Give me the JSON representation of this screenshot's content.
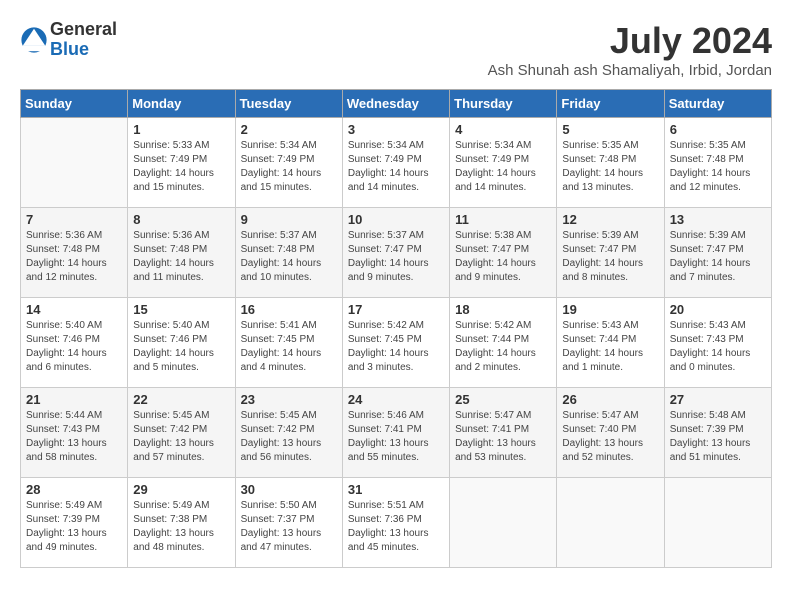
{
  "logo": {
    "general": "General",
    "blue": "Blue"
  },
  "title": "July 2024",
  "location": "Ash Shunah ash Shamaliyah, Irbid, Jordan",
  "weekdays": [
    "Sunday",
    "Monday",
    "Tuesday",
    "Wednesday",
    "Thursday",
    "Friday",
    "Saturday"
  ],
  "weeks": [
    [
      {
        "day": "",
        "sunrise": "",
        "sunset": "",
        "daylight": ""
      },
      {
        "day": "1",
        "sunrise": "Sunrise: 5:33 AM",
        "sunset": "Sunset: 7:49 PM",
        "daylight": "Daylight: 14 hours and 15 minutes."
      },
      {
        "day": "2",
        "sunrise": "Sunrise: 5:34 AM",
        "sunset": "Sunset: 7:49 PM",
        "daylight": "Daylight: 14 hours and 15 minutes."
      },
      {
        "day": "3",
        "sunrise": "Sunrise: 5:34 AM",
        "sunset": "Sunset: 7:49 PM",
        "daylight": "Daylight: 14 hours and 14 minutes."
      },
      {
        "day": "4",
        "sunrise": "Sunrise: 5:34 AM",
        "sunset": "Sunset: 7:49 PM",
        "daylight": "Daylight: 14 hours and 14 minutes."
      },
      {
        "day": "5",
        "sunrise": "Sunrise: 5:35 AM",
        "sunset": "Sunset: 7:48 PM",
        "daylight": "Daylight: 14 hours and 13 minutes."
      },
      {
        "day": "6",
        "sunrise": "Sunrise: 5:35 AM",
        "sunset": "Sunset: 7:48 PM",
        "daylight": "Daylight: 14 hours and 12 minutes."
      }
    ],
    [
      {
        "day": "7",
        "sunrise": "Sunrise: 5:36 AM",
        "sunset": "Sunset: 7:48 PM",
        "daylight": "Daylight: 14 hours and 12 minutes."
      },
      {
        "day": "8",
        "sunrise": "Sunrise: 5:36 AM",
        "sunset": "Sunset: 7:48 PM",
        "daylight": "Daylight: 14 hours and 11 minutes."
      },
      {
        "day": "9",
        "sunrise": "Sunrise: 5:37 AM",
        "sunset": "Sunset: 7:48 PM",
        "daylight": "Daylight: 14 hours and 10 minutes."
      },
      {
        "day": "10",
        "sunrise": "Sunrise: 5:37 AM",
        "sunset": "Sunset: 7:47 PM",
        "daylight": "Daylight: 14 hours and 9 minutes."
      },
      {
        "day": "11",
        "sunrise": "Sunrise: 5:38 AM",
        "sunset": "Sunset: 7:47 PM",
        "daylight": "Daylight: 14 hours and 9 minutes."
      },
      {
        "day": "12",
        "sunrise": "Sunrise: 5:39 AM",
        "sunset": "Sunset: 7:47 PM",
        "daylight": "Daylight: 14 hours and 8 minutes."
      },
      {
        "day": "13",
        "sunrise": "Sunrise: 5:39 AM",
        "sunset": "Sunset: 7:47 PM",
        "daylight": "Daylight: 14 hours and 7 minutes."
      }
    ],
    [
      {
        "day": "14",
        "sunrise": "Sunrise: 5:40 AM",
        "sunset": "Sunset: 7:46 PM",
        "daylight": "Daylight: 14 hours and 6 minutes."
      },
      {
        "day": "15",
        "sunrise": "Sunrise: 5:40 AM",
        "sunset": "Sunset: 7:46 PM",
        "daylight": "Daylight: 14 hours and 5 minutes."
      },
      {
        "day": "16",
        "sunrise": "Sunrise: 5:41 AM",
        "sunset": "Sunset: 7:45 PM",
        "daylight": "Daylight: 14 hours and 4 minutes."
      },
      {
        "day": "17",
        "sunrise": "Sunrise: 5:42 AM",
        "sunset": "Sunset: 7:45 PM",
        "daylight": "Daylight: 14 hours and 3 minutes."
      },
      {
        "day": "18",
        "sunrise": "Sunrise: 5:42 AM",
        "sunset": "Sunset: 7:44 PM",
        "daylight": "Daylight: 14 hours and 2 minutes."
      },
      {
        "day": "19",
        "sunrise": "Sunrise: 5:43 AM",
        "sunset": "Sunset: 7:44 PM",
        "daylight": "Daylight: 14 hours and 1 minute."
      },
      {
        "day": "20",
        "sunrise": "Sunrise: 5:43 AM",
        "sunset": "Sunset: 7:43 PM",
        "daylight": "Daylight: 14 hours and 0 minutes."
      }
    ],
    [
      {
        "day": "21",
        "sunrise": "Sunrise: 5:44 AM",
        "sunset": "Sunset: 7:43 PM",
        "daylight": "Daylight: 13 hours and 58 minutes."
      },
      {
        "day": "22",
        "sunrise": "Sunrise: 5:45 AM",
        "sunset": "Sunset: 7:42 PM",
        "daylight": "Daylight: 13 hours and 57 minutes."
      },
      {
        "day": "23",
        "sunrise": "Sunrise: 5:45 AM",
        "sunset": "Sunset: 7:42 PM",
        "daylight": "Daylight: 13 hours and 56 minutes."
      },
      {
        "day": "24",
        "sunrise": "Sunrise: 5:46 AM",
        "sunset": "Sunset: 7:41 PM",
        "daylight": "Daylight: 13 hours and 55 minutes."
      },
      {
        "day": "25",
        "sunrise": "Sunrise: 5:47 AM",
        "sunset": "Sunset: 7:41 PM",
        "daylight": "Daylight: 13 hours and 53 minutes."
      },
      {
        "day": "26",
        "sunrise": "Sunrise: 5:47 AM",
        "sunset": "Sunset: 7:40 PM",
        "daylight": "Daylight: 13 hours and 52 minutes."
      },
      {
        "day": "27",
        "sunrise": "Sunrise: 5:48 AM",
        "sunset": "Sunset: 7:39 PM",
        "daylight": "Daylight: 13 hours and 51 minutes."
      }
    ],
    [
      {
        "day": "28",
        "sunrise": "Sunrise: 5:49 AM",
        "sunset": "Sunset: 7:39 PM",
        "daylight": "Daylight: 13 hours and 49 minutes."
      },
      {
        "day": "29",
        "sunrise": "Sunrise: 5:49 AM",
        "sunset": "Sunset: 7:38 PM",
        "daylight": "Daylight: 13 hours and 48 minutes."
      },
      {
        "day": "30",
        "sunrise": "Sunrise: 5:50 AM",
        "sunset": "Sunset: 7:37 PM",
        "daylight": "Daylight: 13 hours and 47 minutes."
      },
      {
        "day": "31",
        "sunrise": "Sunrise: 5:51 AM",
        "sunset": "Sunset: 7:36 PM",
        "daylight": "Daylight: 13 hours and 45 minutes."
      },
      {
        "day": "",
        "sunrise": "",
        "sunset": "",
        "daylight": ""
      },
      {
        "day": "",
        "sunrise": "",
        "sunset": "",
        "daylight": ""
      },
      {
        "day": "",
        "sunrise": "",
        "sunset": "",
        "daylight": ""
      }
    ]
  ]
}
